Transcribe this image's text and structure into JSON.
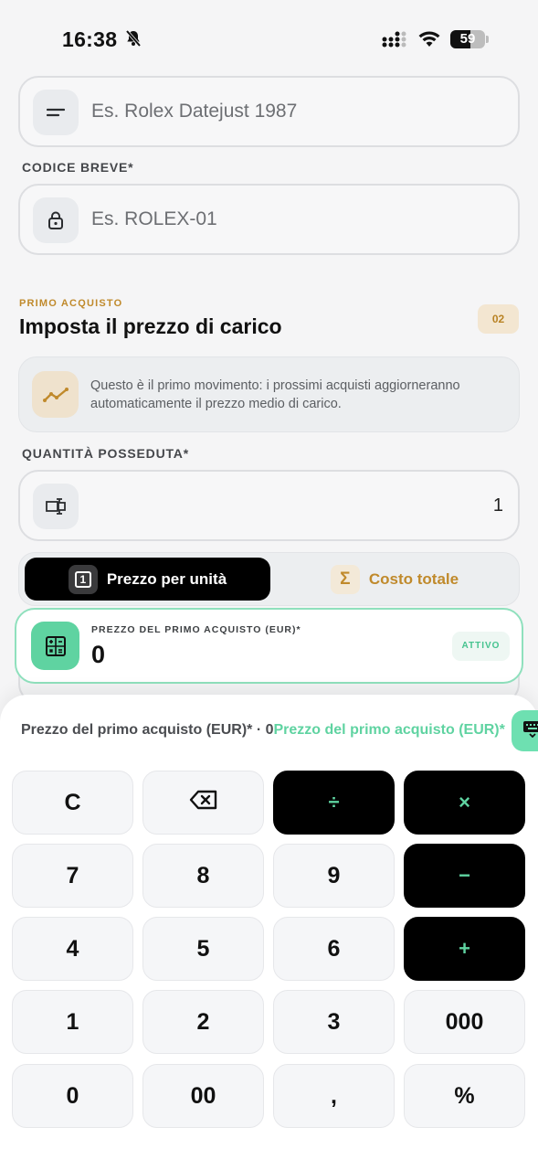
{
  "status_bar": {
    "time": "16:38",
    "battery": "59",
    "battery_level": 0.59
  },
  "name_field": {
    "placeholder": "Es. Rolex Datejust 1987",
    "icon": "menu-lines-icon"
  },
  "short_code": {
    "label": "CODICE BREVE*",
    "placeholder": "Es. ROLEX-01",
    "icon": "lock-icon"
  },
  "section": {
    "eyebrow": "PRIMO ACQUISTO",
    "title": "Imposta il prezzo di carico",
    "step": "02"
  },
  "info": {
    "text": "Questo è il primo movimento: i prossimi acquisti aggiorneranno automaticamente il prezzo medio di carico.",
    "icon": "trend-line-icon"
  },
  "quantity": {
    "label": "QUANTITÀ POSSEDUTA*",
    "value": "1",
    "icon": "quantity-icon"
  },
  "mode_toggle": {
    "active_label": "Prezzo per unità",
    "active_icon": "1",
    "inactive_label": "Costo totale",
    "inactive_icon": "Σ"
  },
  "price": {
    "label": "PREZZO DEL PRIMO ACQUISTO (EUR)*",
    "value": "0",
    "badge": "ATTIVO",
    "icon": "calculator-icon"
  },
  "keypad": {
    "header_prefix": "Prezzo del primo acquisto (EUR)* · 0",
    "header_accent": "Prezzo del primo acquisto (EUR)*",
    "accent_color": "#5fd3a1",
    "keys": {
      "clear": "C",
      "divide": "÷",
      "multiply": "×",
      "seven": "7",
      "eight": "8",
      "nine": "9",
      "minus": "−",
      "four": "4",
      "five": "5",
      "six": "6",
      "plus": "+",
      "one": "1",
      "two": "2",
      "three": "3",
      "triple_zero": "000",
      "zero": "0",
      "double_zero": "00",
      "comma": ",",
      "percent": "%"
    }
  }
}
